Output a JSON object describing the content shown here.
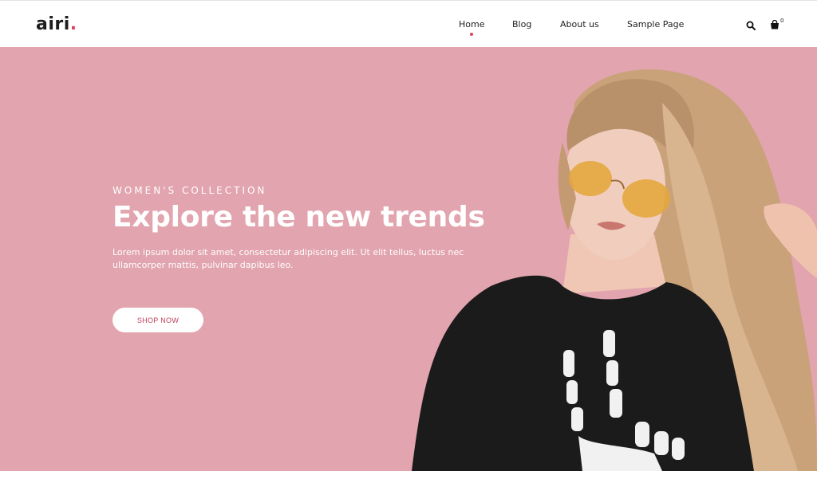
{
  "header": {
    "logo_text": "airi",
    "logo_dot": ".",
    "nav": [
      {
        "label": "Home",
        "active": true
      },
      {
        "label": "Blog",
        "active": false
      },
      {
        "label": "About us",
        "active": false
      },
      {
        "label": "Sample Page",
        "active": false
      }
    ],
    "search_icon": "search-icon",
    "cart_icon": "shopping-bag-icon",
    "cart_count": "0"
  },
  "hero": {
    "eyebrow": "WOMEN'S COLLECTION",
    "headline": "Explore the new trends",
    "description": "Lorem ipsum dolor sit amet, consectetur adipiscing elit. Ut elit tellus, luctus nec ullamcorper mattis, pulvinar dapibus leo.",
    "cta_label": "SHOP NOW"
  },
  "colors": {
    "hero_background": "#e2a4ae",
    "accent": "#e0435e",
    "cta_text": "#c0405a",
    "text_dark": "#222222"
  }
}
